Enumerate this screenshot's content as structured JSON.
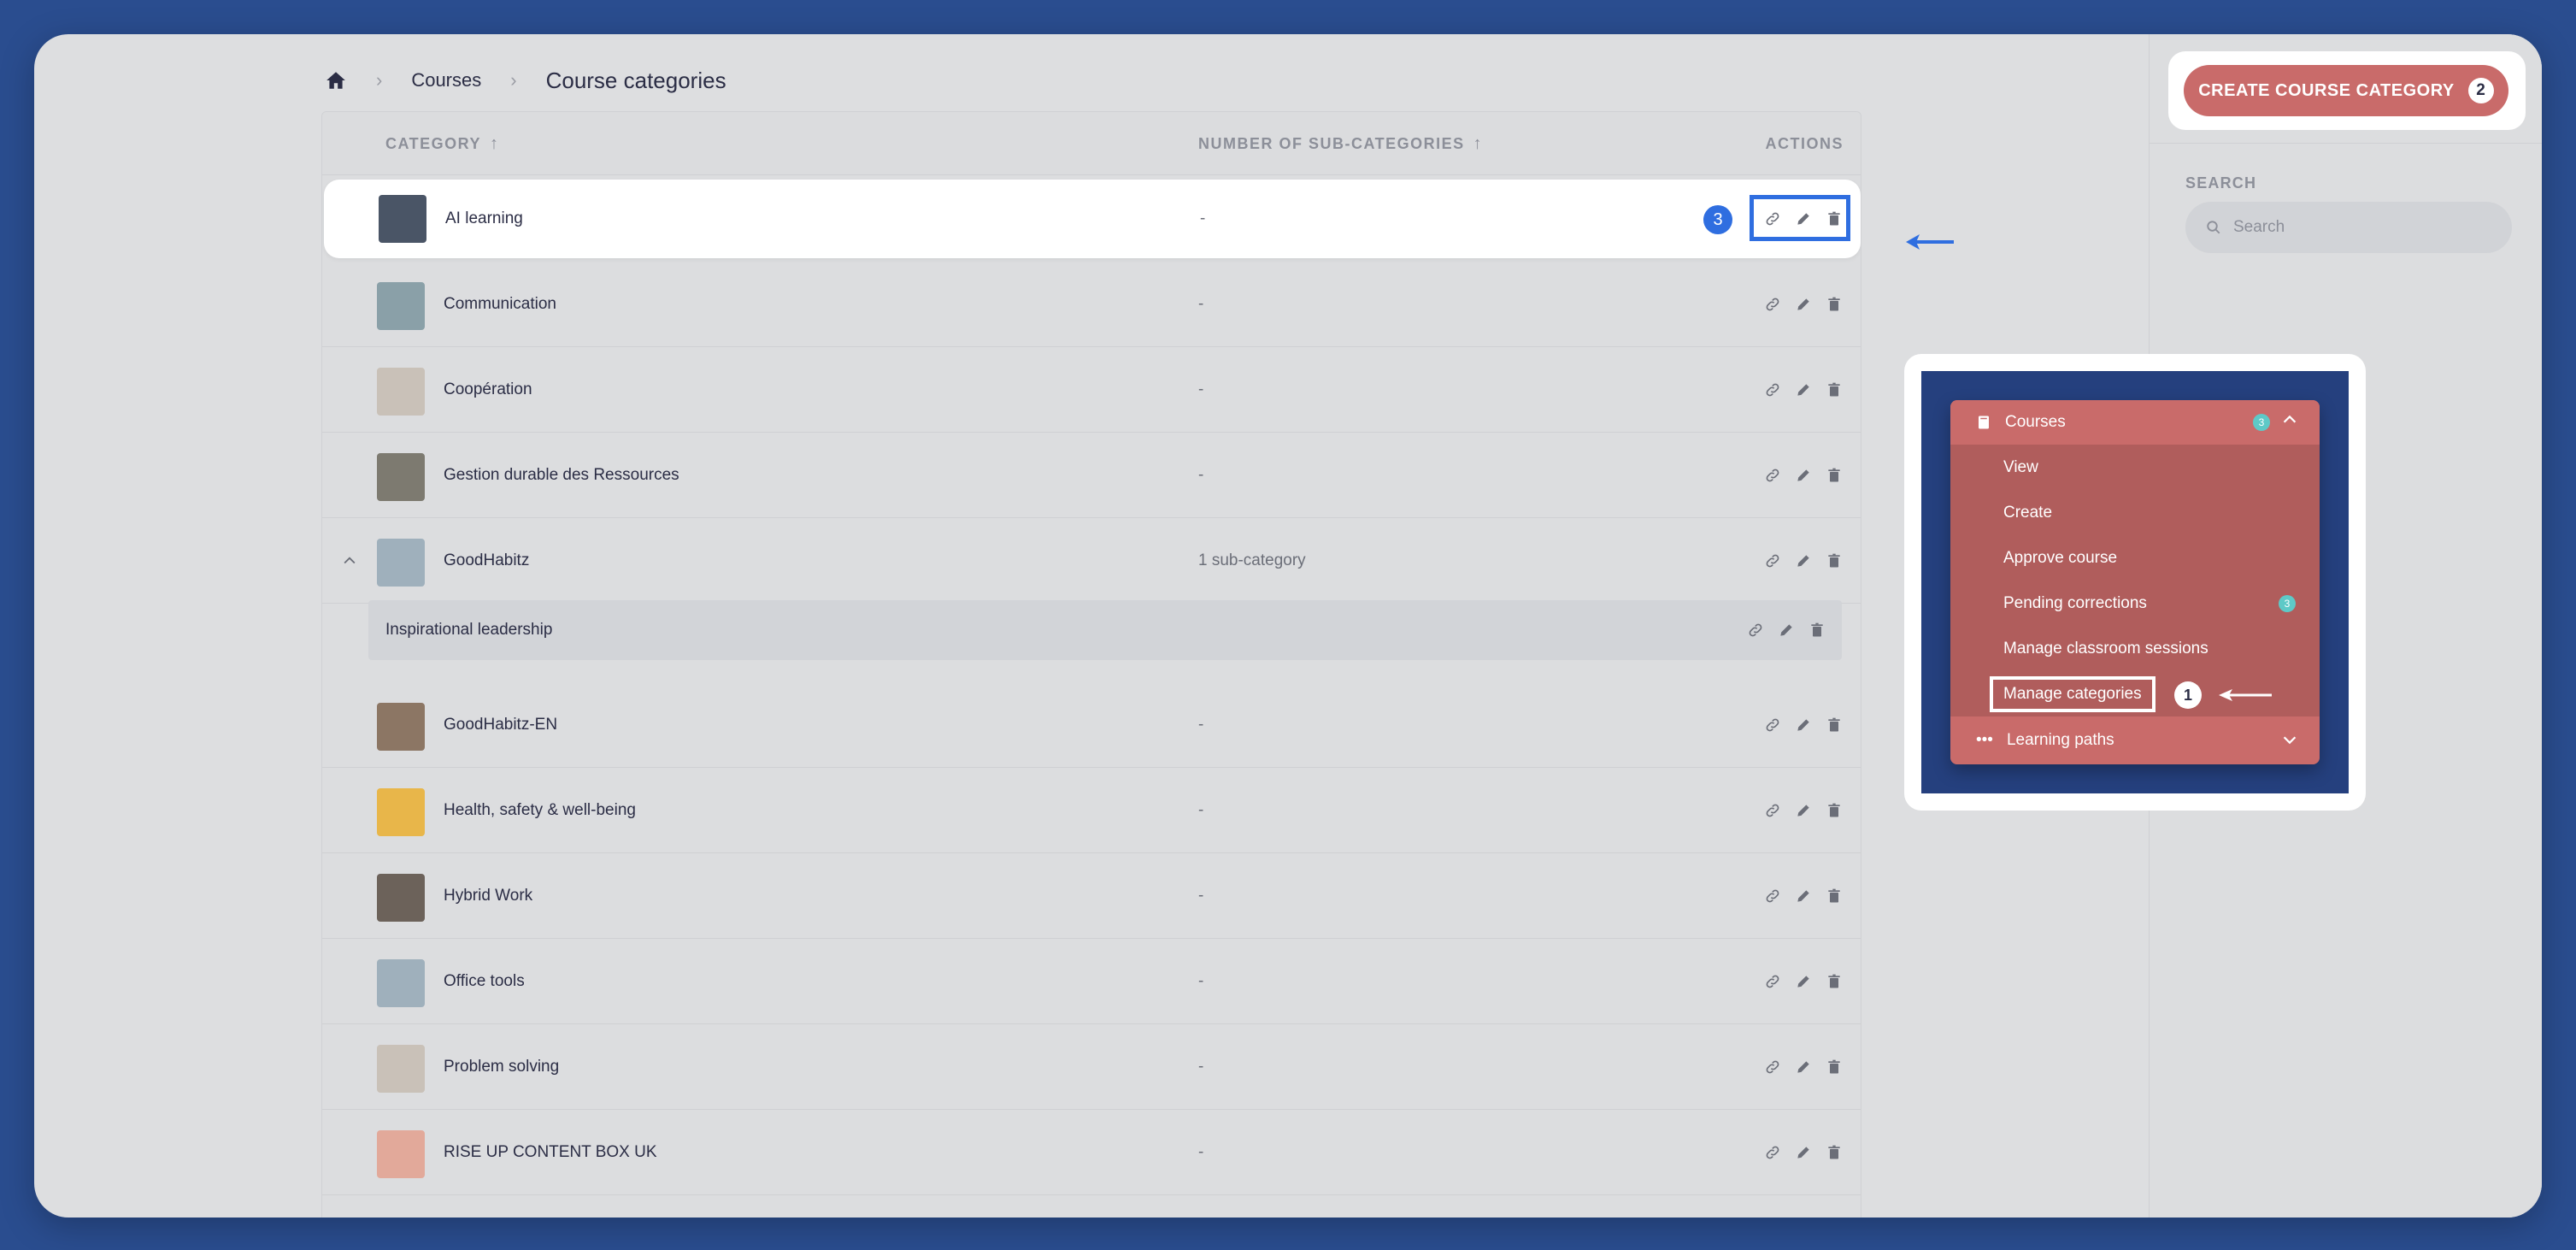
{
  "breadcrumb": {
    "home_icon": "home-icon",
    "parent": "Courses",
    "current": "Course categories"
  },
  "table": {
    "headers": {
      "category": "CATEGORY",
      "subcategories": "NUMBER OF SUB-CATEGORIES",
      "actions": "ACTIONS"
    },
    "rows": [
      {
        "name": "AI learning",
        "subcount": "-",
        "thumb_color": "#4a5566"
      },
      {
        "name": "Communication",
        "subcount": "-",
        "thumb_color": "#8aa0a8"
      },
      {
        "name": "Coopération",
        "subcount": "-",
        "thumb_color": "#c9c1b8"
      },
      {
        "name": "Gestion durable des Ressources",
        "subcount": "-",
        "thumb_color": "#7d7a70"
      },
      {
        "name": "GoodHabitz",
        "subcount": "1 sub-category",
        "thumb_color": "#9fb0bc"
      },
      {
        "name": "GoodHabitz-EN",
        "subcount": "-",
        "thumb_color": "#8c7664"
      },
      {
        "name": "Health, safety & well-being",
        "subcount": "-",
        "thumb_color": "#e8b64a"
      },
      {
        "name": "Hybrid Work",
        "subcount": "-",
        "thumb_color": "#6c625a"
      },
      {
        "name": "Office tools",
        "subcount": "-",
        "thumb_color": "#9fb0bc"
      },
      {
        "name": "Problem solving",
        "subcount": "-",
        "thumb_color": "#c9c1b8"
      },
      {
        "name": "RISE UP CONTENT BOX UK",
        "subcount": "-",
        "thumb_color": "#e2a99a"
      }
    ],
    "subrow": {
      "name": "Inspirational leadership"
    },
    "annotation_badge": "3"
  },
  "sidebar": {
    "create_button": "CREATE COURSE CATEGORY",
    "create_badge": "2",
    "search_label": "SEARCH",
    "search_placeholder": "Search"
  },
  "inset_menu": {
    "section": "Courses",
    "section_badge": "3",
    "items": [
      {
        "label": "View"
      },
      {
        "label": "Create"
      },
      {
        "label": "Approve course"
      },
      {
        "label": "Pending corrections",
        "badge": "3"
      },
      {
        "label": "Manage classroom sessions"
      },
      {
        "label": "Manage categories"
      }
    ],
    "annotation_badge": "1",
    "footer": "Learning paths"
  },
  "colors": {
    "accent_red": "#c96b6a",
    "annotation_blue": "#2f6ee0",
    "background": "#2a4d8f"
  }
}
